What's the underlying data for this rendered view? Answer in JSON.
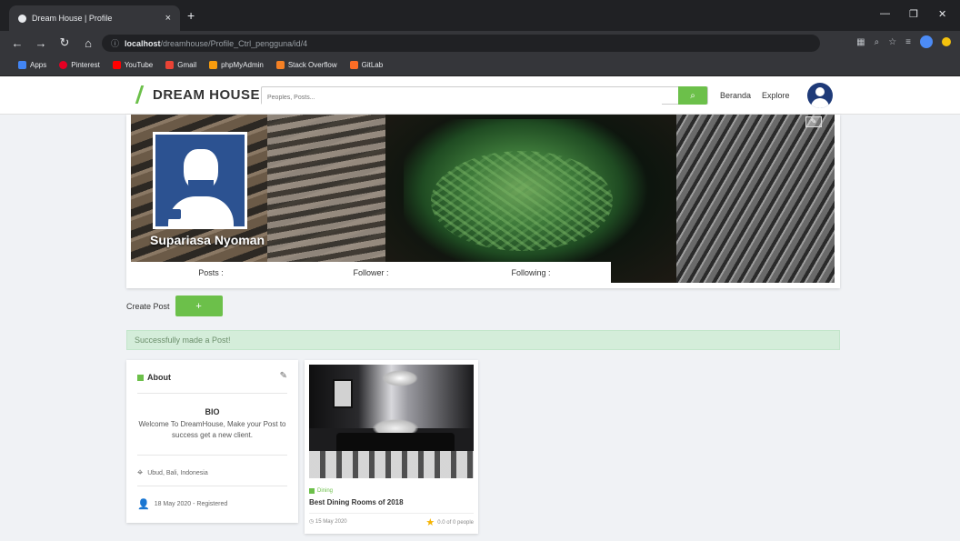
{
  "browser": {
    "tab_title": "Dream House | Profile",
    "tab_close": "×",
    "new_tab": "+",
    "url_host": "localhost",
    "url_path": "/dreamhouse/Profile_Ctrl_pengguna/id/4",
    "bookmarks": [
      "Apps",
      "Pinterest",
      "YouTube",
      "Gmail",
      "phpMyAdmin",
      "Stack Overflow",
      "GitLab"
    ]
  },
  "site": {
    "logo": "DREAM HOUSE",
    "search_placeholder": "Peoples, Posts...",
    "nav_beranda": "Beranda",
    "nav_explore": "Explore"
  },
  "profile": {
    "name": "Supariasa Nyoman",
    "posts_label": "Posts :",
    "follower_label": "Follower :",
    "following_label": "Following :"
  },
  "create_post": {
    "label": "Create Post",
    "button": "+"
  },
  "alert": "Successfully made a Post!",
  "about": {
    "title": "About",
    "bio_heading": "BIO",
    "bio_text": "Welcome To DreamHouse, Make your Post to success get a new client.",
    "location": "Ubud, Bali, Indonesia",
    "registered": "18 May 2020 - Registered"
  },
  "post": {
    "category": "Dining",
    "title": "Best Dining Rooms of 2018",
    "date": "15 May 2020",
    "rating": "0.0 of 0 people"
  }
}
